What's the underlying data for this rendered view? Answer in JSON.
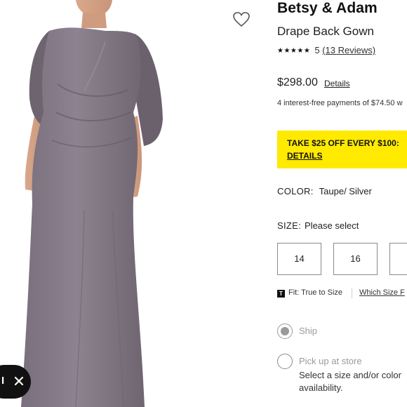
{
  "product": {
    "brand": "Betsy & Adam",
    "name": "Drape Back Gown",
    "stars_glyph": "★★★★★",
    "rating": "5",
    "reviews": "(13 Reviews)",
    "price": "$298.00",
    "price_details_link": "Details",
    "installments": "4 interest-free payments of $74.50 w"
  },
  "promo": {
    "text": "TAKE $25 OFF EVERY $100:",
    "link": "DETAILS",
    "color": "#ffea00"
  },
  "color": {
    "label": "COLOR:",
    "value": "Taupe/ Silver"
  },
  "size": {
    "label": "SIZE:",
    "value": "Please select",
    "options": [
      "14",
      "16",
      ""
    ]
  },
  "fit": {
    "icon_letter": "T",
    "text": "Fit: True to Size",
    "link": "Which Size F"
  },
  "fulfillment": {
    "ship_label": "Ship",
    "pickup_label": "Pick up at store",
    "pickup_note_line1": "Select a size and/or color",
    "pickup_note_line2": "availability."
  },
  "chat": {
    "dot_label": "I"
  },
  "icons": {
    "wishlist": "heart-icon",
    "close": "close-icon",
    "fit": "fit-t-icon"
  }
}
